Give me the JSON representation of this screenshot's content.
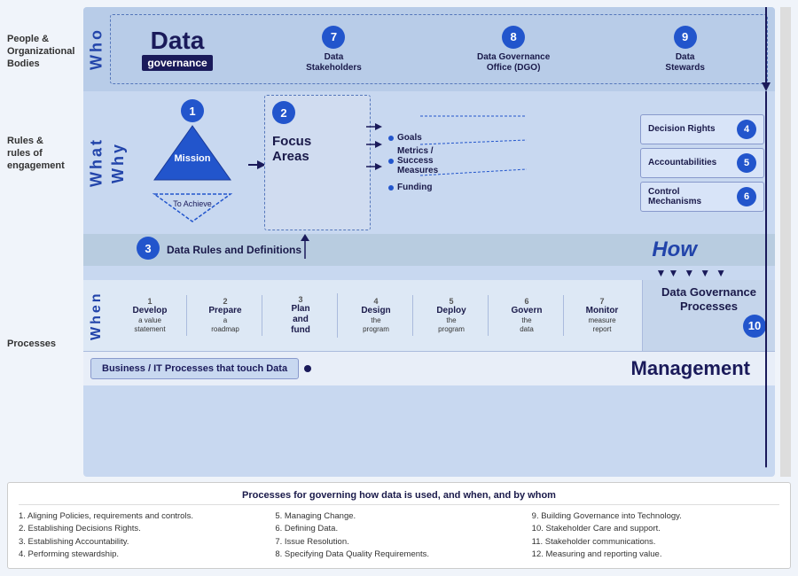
{
  "labels": {
    "people": "People &\nOrganizational\nBodies",
    "rules": "Rules &\nrules of\nengagement",
    "processes": "Processes"
  },
  "axis": {
    "who": "Who",
    "what": "What",
    "why": "Why",
    "when": "When",
    "how": "How"
  },
  "who_items": [
    {
      "number": "7",
      "label": "Data\nStakeholders"
    },
    {
      "number": "8",
      "label": "Data Governance\nOffice (DGO)"
    },
    {
      "number": "9",
      "label": "Data\nStewards"
    }
  ],
  "mission": {
    "badge": "1",
    "title": "Mission",
    "subtitle": "To Achieve"
  },
  "focus_areas": {
    "badge": "2",
    "title": "Focus\nAreas"
  },
  "goals": [
    "Goals",
    "Metrics /\nSuccess\nMeasures",
    "Funding"
  ],
  "decision_boxes": [
    {
      "number": "4",
      "label": "Decision Rights"
    },
    {
      "number": "5",
      "label": "Accountabilities"
    },
    {
      "number": "6",
      "label": "Control\nMechanisms"
    }
  ],
  "data_rules": {
    "badge": "3",
    "text": "Data Rules and Definitions"
  },
  "process_steps": [
    {
      "num": "1",
      "title": "Develop",
      "desc": "a value\nstatement"
    },
    {
      "num": "2",
      "title": "Prepare",
      "desc": "a\nroadmap"
    },
    {
      "num": "3",
      "title": "Plan\nand\nfund",
      "desc": ""
    },
    {
      "num": "4",
      "title": "Design",
      "desc": "the\nprogram"
    },
    {
      "num": "5",
      "title": "Deploy",
      "desc": "the\nprogram"
    },
    {
      "num": "6",
      "title": "Govern",
      "desc": "the\ndata"
    },
    {
      "num": "7",
      "title": "Monitor",
      "desc": "measure\nreport"
    }
  ],
  "dgp": {
    "title": "Data Governance\nProcesses",
    "badge": "10"
  },
  "business_it": {
    "text": "Business / IT Processes that touch Data"
  },
  "management": "Management",
  "bottom": {
    "title": "Processes for governing how data is used, and when, and by whom",
    "col1": [
      "1. Aligning Policies, requirements and controls.",
      "2. Establishing Decisions Rights.",
      "3. Establishing Accountability.",
      "4. Performing stewardship."
    ],
    "col2": [
      "5. Managing Change.",
      "6. Defining Data.",
      "7. Issue Resolution.",
      "8. Specifying Data Quality Requirements."
    ],
    "col3": [
      "9. Building Governance into Technology.",
      "10. Stakeholder Care and support.",
      "11. Stakeholder communications.",
      "12. Measuring and reporting value."
    ]
  },
  "dg_logo": {
    "data": "Data",
    "governance": "governance"
  }
}
